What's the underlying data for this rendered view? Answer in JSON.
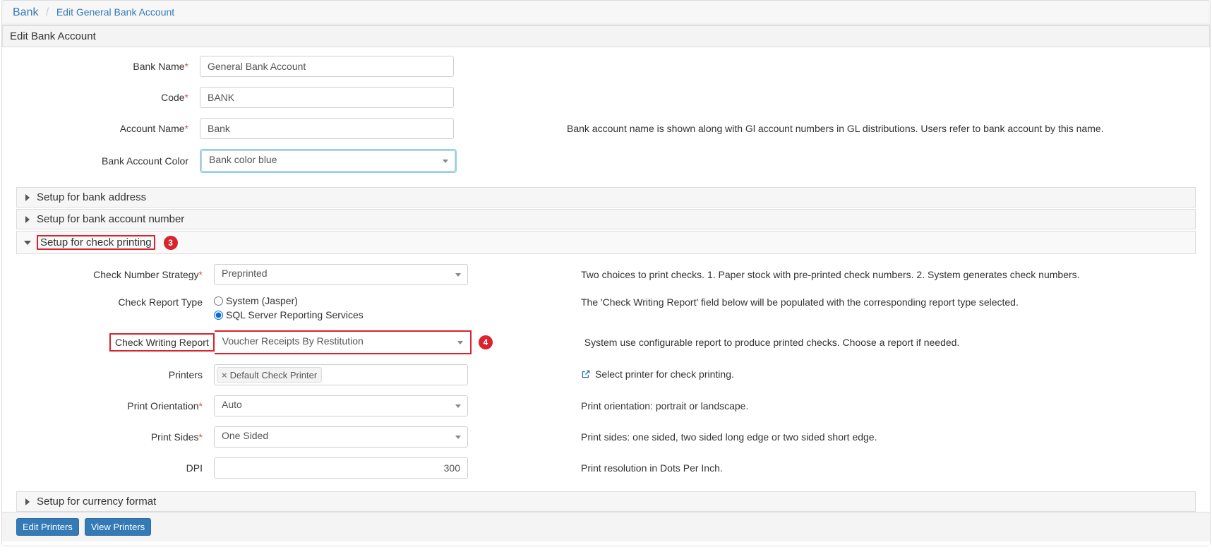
{
  "breadcrumb": {
    "root": "Bank",
    "current": "Edit General Bank Account"
  },
  "panel_title": "Edit Bank Account",
  "fields": {
    "bank_name": {
      "label": "Bank Name",
      "value": "General Bank Account"
    },
    "code": {
      "label": "Code",
      "value": "BANK"
    },
    "account_name": {
      "label": "Account Name",
      "value": "Bank",
      "help": "Bank account name is shown along with Gl account numbers in GL distributions. Users refer to bank account by this name."
    },
    "bank_account_color": {
      "label": "Bank Account Color",
      "value": "Bank color blue"
    }
  },
  "sections": {
    "bank_address": "Setup for bank address",
    "bank_account_number": "Setup for bank account number",
    "check_printing": "Setup for check printing",
    "currency_format": "Setup for currency format"
  },
  "check_printing": {
    "check_number_strategy": {
      "label": "Check Number Strategy",
      "value": "Preprinted",
      "help": "Two choices to print checks. 1. Paper stock with pre-printed check numbers. 2. System generates check numbers."
    },
    "check_report_type": {
      "label": "Check Report Type",
      "options": {
        "system": "System (Jasper)",
        "ssrs": "SQL Server Reporting Services"
      },
      "selected": "ssrs",
      "help": "The 'Check Writing Report' field below will be populated with the corresponding report type selected."
    },
    "check_writing_report": {
      "label": "Check Writing Report",
      "value": "Voucher Receipts By Restitution",
      "help": "System use configurable report to produce printed checks. Choose a report if needed."
    },
    "printers": {
      "label": "Printers",
      "chips": [
        "Default Check Printer"
      ],
      "help_link": "Select printer for check printing."
    },
    "print_orientation": {
      "label": "Print Orientation",
      "value": "Auto",
      "help": "Print orientation: portrait or landscape."
    },
    "print_sides": {
      "label": "Print Sides",
      "value": "One Sided",
      "help": "Print sides: one sided, two sided long edge or two sided short edge."
    },
    "dpi": {
      "label": "DPI",
      "value": "300",
      "help": "Print resolution in Dots Per Inch."
    }
  },
  "callouts": {
    "section_badge": "3",
    "report_badge": "4"
  },
  "footer": {
    "edit_printers": "Edit Printers",
    "view_printers": "View Printers"
  }
}
